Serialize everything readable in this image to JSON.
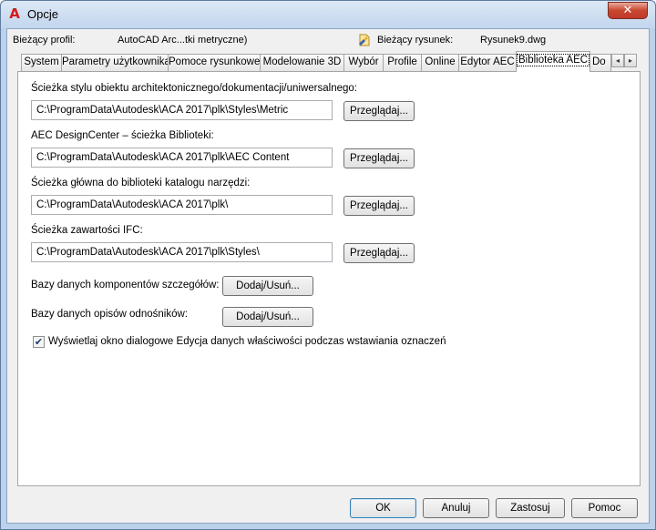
{
  "window": {
    "title": "Opcje",
    "app_icon_glyph": "A",
    "close_glyph": "✕"
  },
  "profile": {
    "label": "Bieżący profil:",
    "value": "AutoCAD Arc...tki metryczne)",
    "drawing_label": "Bieżący rysunek:",
    "drawing_value": "Rysunek9.dwg"
  },
  "tabs": [
    {
      "label": "System"
    },
    {
      "label": "Parametry użytkownika"
    },
    {
      "label": "Pomoce rysunkowe"
    },
    {
      "label": "Modelowanie 3D"
    },
    {
      "label": "Wybór"
    },
    {
      "label": "Profile"
    },
    {
      "label": "Online"
    },
    {
      "label": "Edytor AEC"
    },
    {
      "label": "Biblioteka AEC",
      "active": true
    },
    {
      "label": "Do"
    }
  ],
  "tab_scroll": {
    "left": "◂",
    "right": "▸"
  },
  "sections": [
    {
      "label": "Ścieżka stylu obiektu architektonicznego/dokumentacji/uniwersalnego:",
      "value": "C:\\ProgramData\\Autodesk\\ACA 2017\\plk\\Styles\\Metric",
      "button": "Przeglądaj..."
    },
    {
      "label": "AEC DesignCenter – ścieżka Biblioteki:",
      "value": "C:\\ProgramData\\Autodesk\\ACA 2017\\plk\\AEC Content",
      "button": "Przeglądaj..."
    },
    {
      "label": "Ścieżka główna do biblioteki katalogu narzędzi:",
      "value": "C:\\ProgramData\\Autodesk\\ACA 2017\\plk\\",
      "button": "Przeglądaj..."
    },
    {
      "label": "Ścieżka zawartości IFC:",
      "value": "C:\\ProgramData\\Autodesk\\ACA 2017\\plk\\Styles\\",
      "button": "Przeglądaj..."
    }
  ],
  "databases": [
    {
      "label": "Bazy danych komponentów szczegółów:",
      "button": "Dodaj/Usuń..."
    },
    {
      "label": "Bazy danych opisów odnośników:",
      "button": "Dodaj/Usuń..."
    }
  ],
  "checkbox": {
    "label": "Wyświetlaj okno dialogowe Edycja danych właściwości podczas wstawiania oznaczeń",
    "checked_glyph": "✔"
  },
  "footer": {
    "ok": "OK",
    "cancel": "Anuluj",
    "apply": "Zastosuj",
    "help": "Pomoc"
  }
}
